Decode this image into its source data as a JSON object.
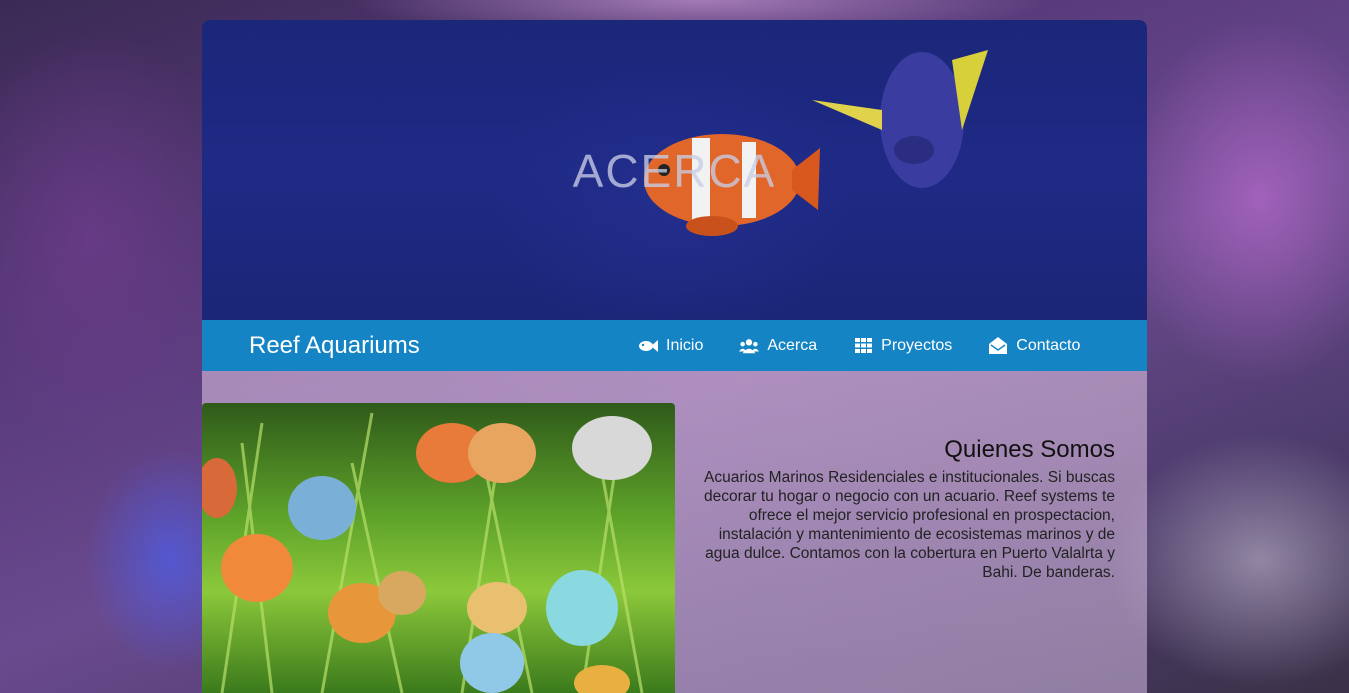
{
  "hero": {
    "title": "ACERCA"
  },
  "navbar": {
    "brand": "Reef Aquariums",
    "items": [
      {
        "label": "Inicio",
        "icon": "fish-icon"
      },
      {
        "label": "Acerca",
        "icon": "users-icon"
      },
      {
        "label": "Proyectos",
        "icon": "grid-icon"
      },
      {
        "label": "Contacto",
        "icon": "envelope-open-icon"
      }
    ]
  },
  "about": {
    "heading": "Quienes Somos",
    "body": "Acuarios Marinos Residenciales e institucionales. Si buscas decorar tu hogar o negocio con un acuario. Reef systems te ofrece el mejor servicio profesional en prospectacion, instalación y mantenimiento de ecosistemas marinos y de agua dulce. Contamos con la cobertura en Puerto Valalrta y Bahi. De banderas."
  },
  "colors": {
    "navbar": "#1484c4",
    "hero_background": "#1e2a85",
    "nav_text": "#ffffff"
  }
}
